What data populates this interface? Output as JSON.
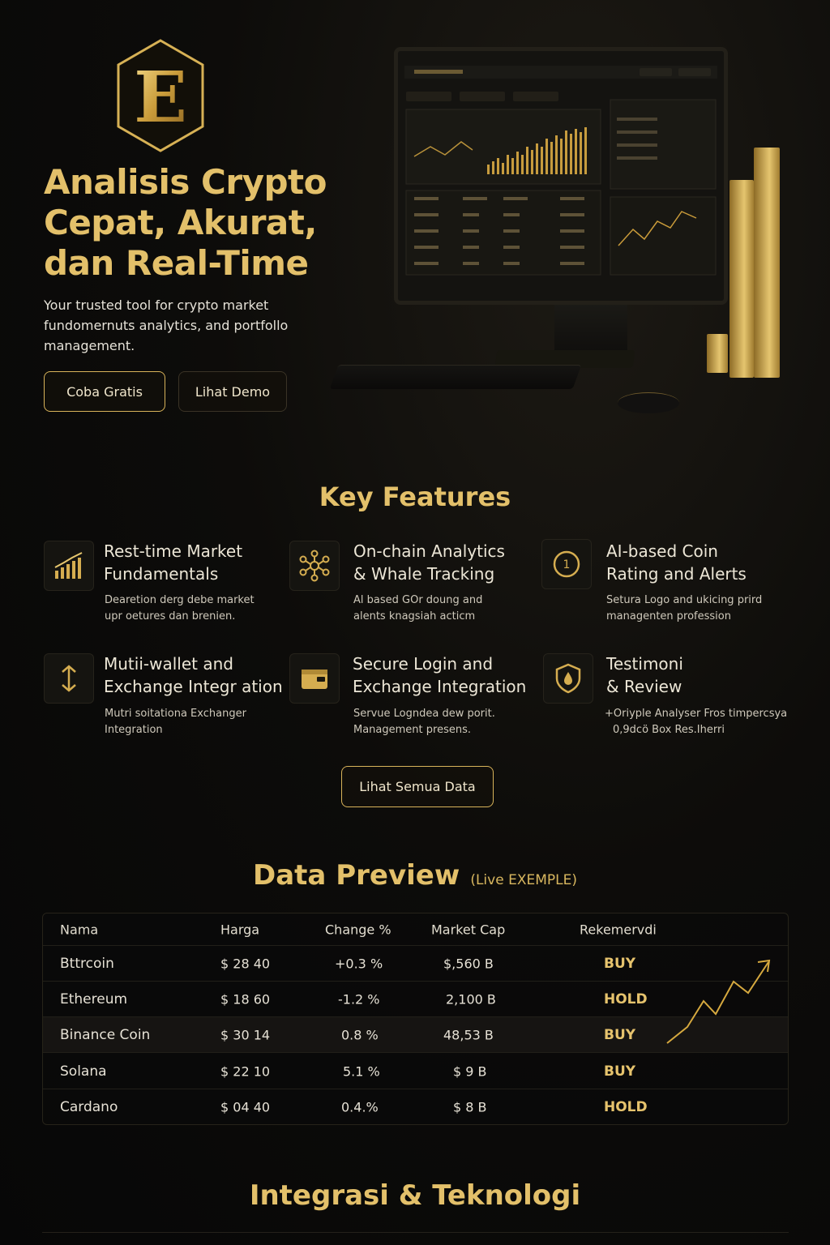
{
  "hero": {
    "logo_letter": "E",
    "title": [
      "Analisis Crypto",
      "Cepat, Akurat,",
      "dan Real-Time"
    ],
    "subtitle": [
      "Your trusted tool for crypto market",
      "fundomernuts analytics, and portfollo",
      "management."
    ],
    "btn_free": "Coba Gratis",
    "btn_demo": "Lihat Demo"
  },
  "features": {
    "title": "Key Features",
    "items": [
      {
        "icon": "bar-chart-icon",
        "title": [
          "Rest-time Market",
          "Fundamentals"
        ],
        "desc": [
          "Dearetion derg debe market",
          "upr oetures dan brenien."
        ]
      },
      {
        "icon": "network-nodes-icon",
        "title": [
          "On-chain Analytics",
          "& Whale Tracking"
        ],
        "desc": [
          "Al based GOr doung and",
          "alents knagsiah acticm"
        ]
      },
      {
        "icon": "rating-circle-icon",
        "title": [
          "AI-based Coin",
          "Rating and Alerts"
        ],
        "desc": [
          "Setura Logo and ukicing prird",
          "managenten profession"
        ]
      },
      {
        "icon": "transfer-arrows-icon",
        "title": [
          "Mutii-wallet and",
          "Exchange Integr ation"
        ],
        "desc": [
          "Mutri soitationa Exchanger",
          "Integration"
        ]
      },
      {
        "icon": "wallet-icon",
        "title": [
          "Secure Login and",
          "Exchange Integration"
        ],
        "desc": [
          "Servue Logndea dew porit.",
          "Management presens."
        ]
      },
      {
        "icon": "shield-icon",
        "title": [
          "Testimoni",
          "& Review"
        ],
        "desc": [
          "+Oriyple Analyser Fros timpercsya",
          "0,9dcö Box Res.Iherri"
        ]
      }
    ],
    "btn_all": "Lihat Semua Data"
  },
  "preview": {
    "title": "Data Preview",
    "subtitle": "(Live EXEMPLE)",
    "columns": [
      "Nama",
      "Harga",
      "Change %",
      "Market Cap",
      "Rekemervdi"
    ],
    "rows": [
      [
        "Bttrcoin",
        "$ 28 40",
        "+0.3 %",
        "$,560 B",
        "BUY"
      ],
      [
        "Ethereum",
        "$ 18 60",
        "-1.2 %",
        "2,100 B",
        "HOLD"
      ],
      [
        "Binance Coin",
        "$ 30 14",
        "0.8 %",
        "48,53 B",
        "BUY"
      ],
      [
        "Solana",
        "$ 22 10",
        "5.1 %",
        "$ 9 B",
        "BUY"
      ],
      [
        "Cardano",
        "$ 04 40",
        "0.4.%",
        "$ 8 B",
        "HOLD"
      ]
    ]
  },
  "integration": {
    "title": "Integrasi & Teknologi"
  },
  "colors": {
    "gold": "#e3c06a",
    "background": "#0b0a09",
    "text": "#e9e4d8"
  }
}
